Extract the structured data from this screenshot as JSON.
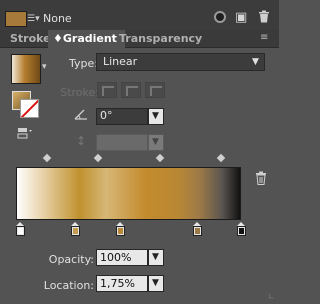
{
  "top": {
    "fill_label": "None",
    "icons": [
      "swatch-menu-icon",
      "color-wheel-icon",
      "new-swatch-icon",
      "trash-icon"
    ]
  },
  "tabs": [
    {
      "label": "Stroke",
      "active": false
    },
    {
      "label": "♦Gradient",
      "active": true
    },
    {
      "label": "Transparency",
      "active": false
    }
  ],
  "panel_menu": "≡",
  "type": {
    "label": "Type:",
    "value": "Linear"
  },
  "stroke": {
    "label": "Stroke:"
  },
  "angle": {
    "value": "0°"
  },
  "aspect": {
    "value": ""
  },
  "gradient": {
    "stops": [
      {
        "color": "#ffffff",
        "location": 1.75
      },
      {
        "color": "#c49a4c",
        "location": 24
      },
      {
        "color": "#b98834",
        "location": 46
      },
      {
        "color": "#9c7a48",
        "location": 81
      },
      {
        "color": "#111111",
        "location": 100
      }
    ],
    "midpoints": 4
  },
  "opacity": {
    "label": "Opacity:",
    "value": "100%"
  },
  "location": {
    "label": "Location:",
    "value": "1,75%"
  },
  "colors": {
    "panel_bg": "#535353",
    "input_bg": "#e8e8e8",
    "accent": "#c38a2c"
  }
}
